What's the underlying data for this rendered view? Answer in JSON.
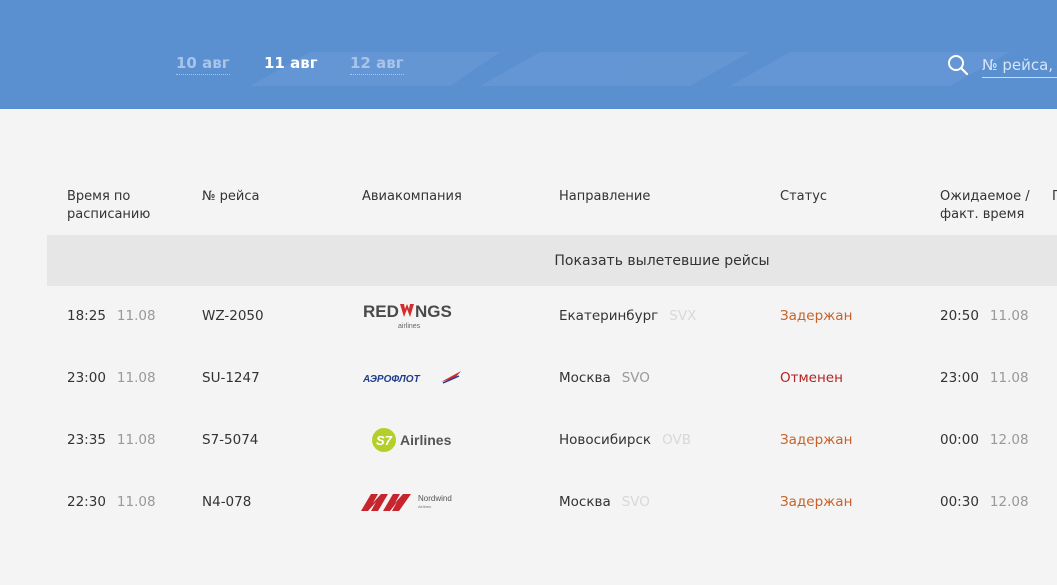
{
  "header": {
    "dates": [
      {
        "label": "10 авг",
        "active": false
      },
      {
        "label": "11 авг",
        "active": true
      },
      {
        "label": "12 авг",
        "active": false
      }
    ],
    "search_placeholder": "№ рейса, город"
  },
  "table": {
    "columns": {
      "scheduled": "Время по\nрасписанию",
      "flight": "№ рейса",
      "airline": "Авиакомпания",
      "destination": "Направление",
      "status": "Статус",
      "expected": "Ожидаемое /\nфакт. время",
      "extra": "П"
    },
    "show_departed": "Показать вылетевшие рейсы",
    "rows": [
      {
        "time": "18:25",
        "date": "11.08",
        "flight": "WZ-2050",
        "airline_logo": "redwings-logo",
        "airline_text": "REDWINGS",
        "airline_sub": "airlines",
        "city": "Екатеринбург",
        "code": "SVX",
        "status": "Задержан",
        "status_type": "delayed",
        "exp_time": "20:50",
        "exp_date": "11.08"
      },
      {
        "time": "23:00",
        "date": "11.08",
        "flight": "SU-1247",
        "airline_logo": "aeroflot-logo",
        "airline_text": "АЭРОФЛОТ",
        "airline_sub": "",
        "city": "Москва",
        "code": "SVO",
        "status": "Отменен",
        "status_type": "cancelled",
        "exp_time": "23:00",
        "exp_date": "11.08"
      },
      {
        "time": "23:35",
        "date": "11.08",
        "flight": "S7-5074",
        "airline_logo": "s7-logo",
        "airline_text": "Airlines",
        "airline_sub": "S7",
        "city": "Новосибирск",
        "code": "OVB",
        "status": "Задержан",
        "status_type": "delayed",
        "exp_time": "00:00",
        "exp_date": "12.08"
      },
      {
        "time": "22:30",
        "date": "11.08",
        "flight": "N4-078",
        "airline_logo": "nordwind-logo",
        "airline_text": "Nordwind",
        "airline_sub": "Airlines",
        "city": "Москва",
        "code": "SVO",
        "status": "Задержан",
        "status_type": "delayed",
        "exp_time": "00:30",
        "exp_date": "12.08"
      }
    ]
  },
  "colors": {
    "header_bg": "#5a8fd0",
    "delayed": "#c8622a",
    "cancelled": "#b52222"
  }
}
